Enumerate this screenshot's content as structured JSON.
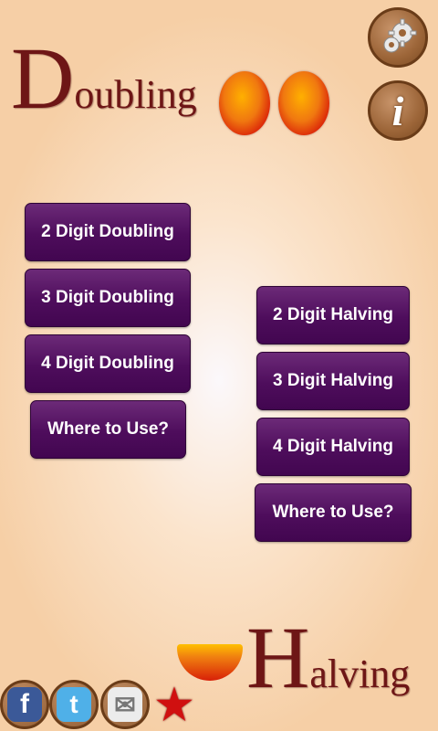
{
  "titles": {
    "doubling_initial": "D",
    "doubling_rest": "oubling",
    "halving_initial": "H",
    "halving_rest": "alving"
  },
  "doubling_menu": [
    {
      "label": "2 Digit Doubling"
    },
    {
      "label": "3 Digit Doubling"
    },
    {
      "label": "4 Digit Doubling"
    },
    {
      "label": "Where to Use?"
    }
  ],
  "halving_menu": [
    {
      "label": "2 Digit Halving"
    },
    {
      "label": "3 Digit Halving"
    },
    {
      "label": "4 Digit Halving"
    },
    {
      "label": "Where to Use?"
    }
  ],
  "top_icons": [
    {
      "name": "settings-gear-icon"
    },
    {
      "name": "info-icon",
      "glyph": "i"
    }
  ],
  "social": [
    {
      "name": "facebook-icon",
      "glyph": "f",
      "color": "#3b5998"
    },
    {
      "name": "twitter-icon",
      "glyph": "t",
      "color": "#4fb0e8"
    },
    {
      "name": "mail-icon",
      "glyph": "✉",
      "color": "#cfcfcf"
    },
    {
      "name": "star-rate-icon",
      "glyph": "★",
      "color": "#d01010"
    }
  ]
}
